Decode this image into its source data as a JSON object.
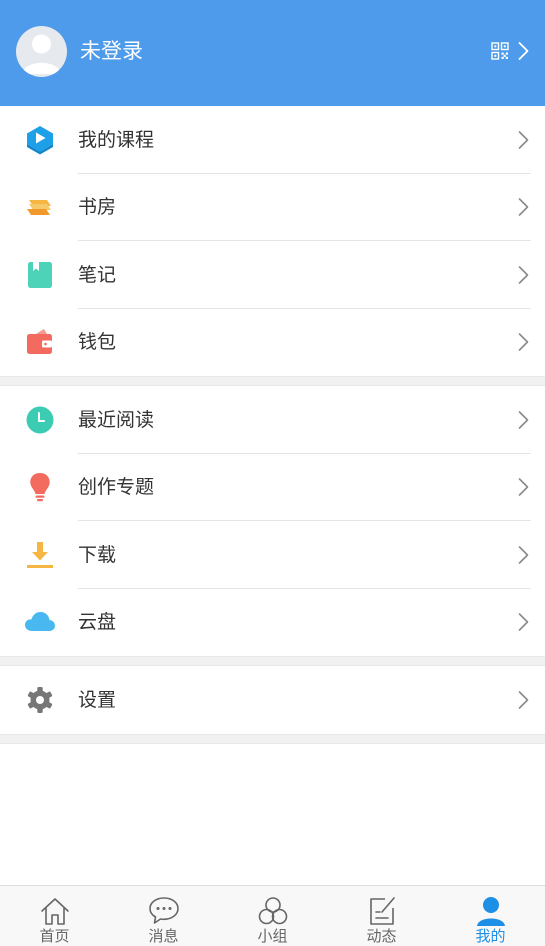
{
  "header": {
    "user_name": "未登录",
    "background": "#4d9bea",
    "icons": [
      "avatar-placeholder",
      "qr-code-icon",
      "chevron-right-icon"
    ]
  },
  "menu_sections": [
    {
      "items": [
        {
          "label": "我的课程",
          "icon": "course-icon",
          "color": "#1ea0e8"
        },
        {
          "label": "书房",
          "icon": "books-icon",
          "color": "#f5b643"
        },
        {
          "label": "笔记",
          "icon": "notebook-icon",
          "color": "#4cd3b8"
        },
        {
          "label": "钱包",
          "icon": "wallet-icon",
          "color": "#f26b5e"
        }
      ]
    },
    {
      "items": [
        {
          "label": "最近阅读",
          "icon": "clock-icon",
          "color": "#3ccbb3"
        },
        {
          "label": "创作专题",
          "icon": "lightbulb-icon",
          "color": "#f26b5e"
        },
        {
          "label": "下载",
          "icon": "download-icon",
          "color": "#f5b643"
        },
        {
          "label": "云盘",
          "icon": "cloud-icon",
          "color": "#4ab8f0"
        }
      ]
    },
    {
      "items": [
        {
          "label": "设置",
          "icon": "gear-icon",
          "color": "#777777"
        }
      ]
    }
  ],
  "tabbar": {
    "tabs": [
      {
        "label": "首页",
        "icon": "home-icon"
      },
      {
        "label": "消息",
        "icon": "chat-bubble-icon"
      },
      {
        "label": "小组",
        "icon": "group-circles-icon"
      },
      {
        "label": "动态",
        "icon": "edit-note-icon"
      },
      {
        "label": "我的",
        "icon": "user-icon",
        "active": true
      }
    ],
    "active_color": "#1e8fe6"
  }
}
